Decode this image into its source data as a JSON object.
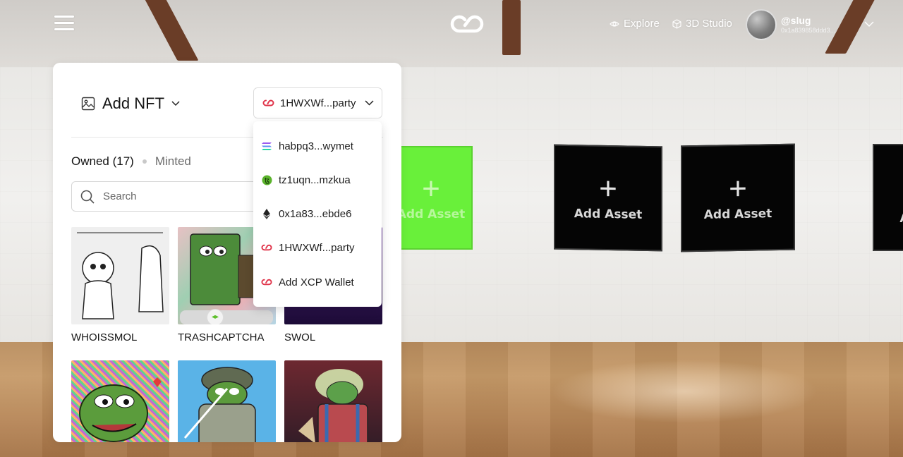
{
  "topbar": {
    "explore_label": "Explore",
    "studio_label": "3D Studio",
    "user": {
      "handle": "@slug",
      "address": "0x1a839858ddd3..."
    }
  },
  "gallery": {
    "frames": [
      {
        "label": "Add Asset",
        "color": "#69f03a"
      },
      {
        "label": "Add Asset",
        "color": "#050505"
      },
      {
        "label": "Add Asset",
        "color": "#050505"
      },
      {
        "label": "A",
        "color": "#050505"
      }
    ]
  },
  "panel": {
    "title": "Add NFT",
    "wallet_selected": "1HWXWf...party",
    "tabs": {
      "owned": "Owned (17)",
      "minted": "Minted"
    },
    "search": {
      "placeholder": "Search",
      "value": ""
    },
    "nfts": [
      {
        "name": "WHOISSMOL"
      },
      {
        "name": "TRASHCAPTCHA"
      },
      {
        "name": "SWOL"
      },
      {
        "name": ""
      },
      {
        "name": ""
      },
      {
        "name": ""
      }
    ]
  },
  "wallet_menu": {
    "items": [
      {
        "label": "habpq3...wymet",
        "icon": "solana-icon"
      },
      {
        "label": "tz1uqn...mzkua",
        "icon": "tezos-icon"
      },
      {
        "label": "0x1a83...ebde6",
        "icon": "ethereum-icon"
      },
      {
        "label": "1HWXWf...party",
        "icon": "xcp-icon"
      },
      {
        "label": "Add XCP Wallet",
        "icon": "xcp-icon"
      }
    ]
  },
  "colors": {
    "accent_red": "#e0344a",
    "frame_green": "#69f03a"
  }
}
